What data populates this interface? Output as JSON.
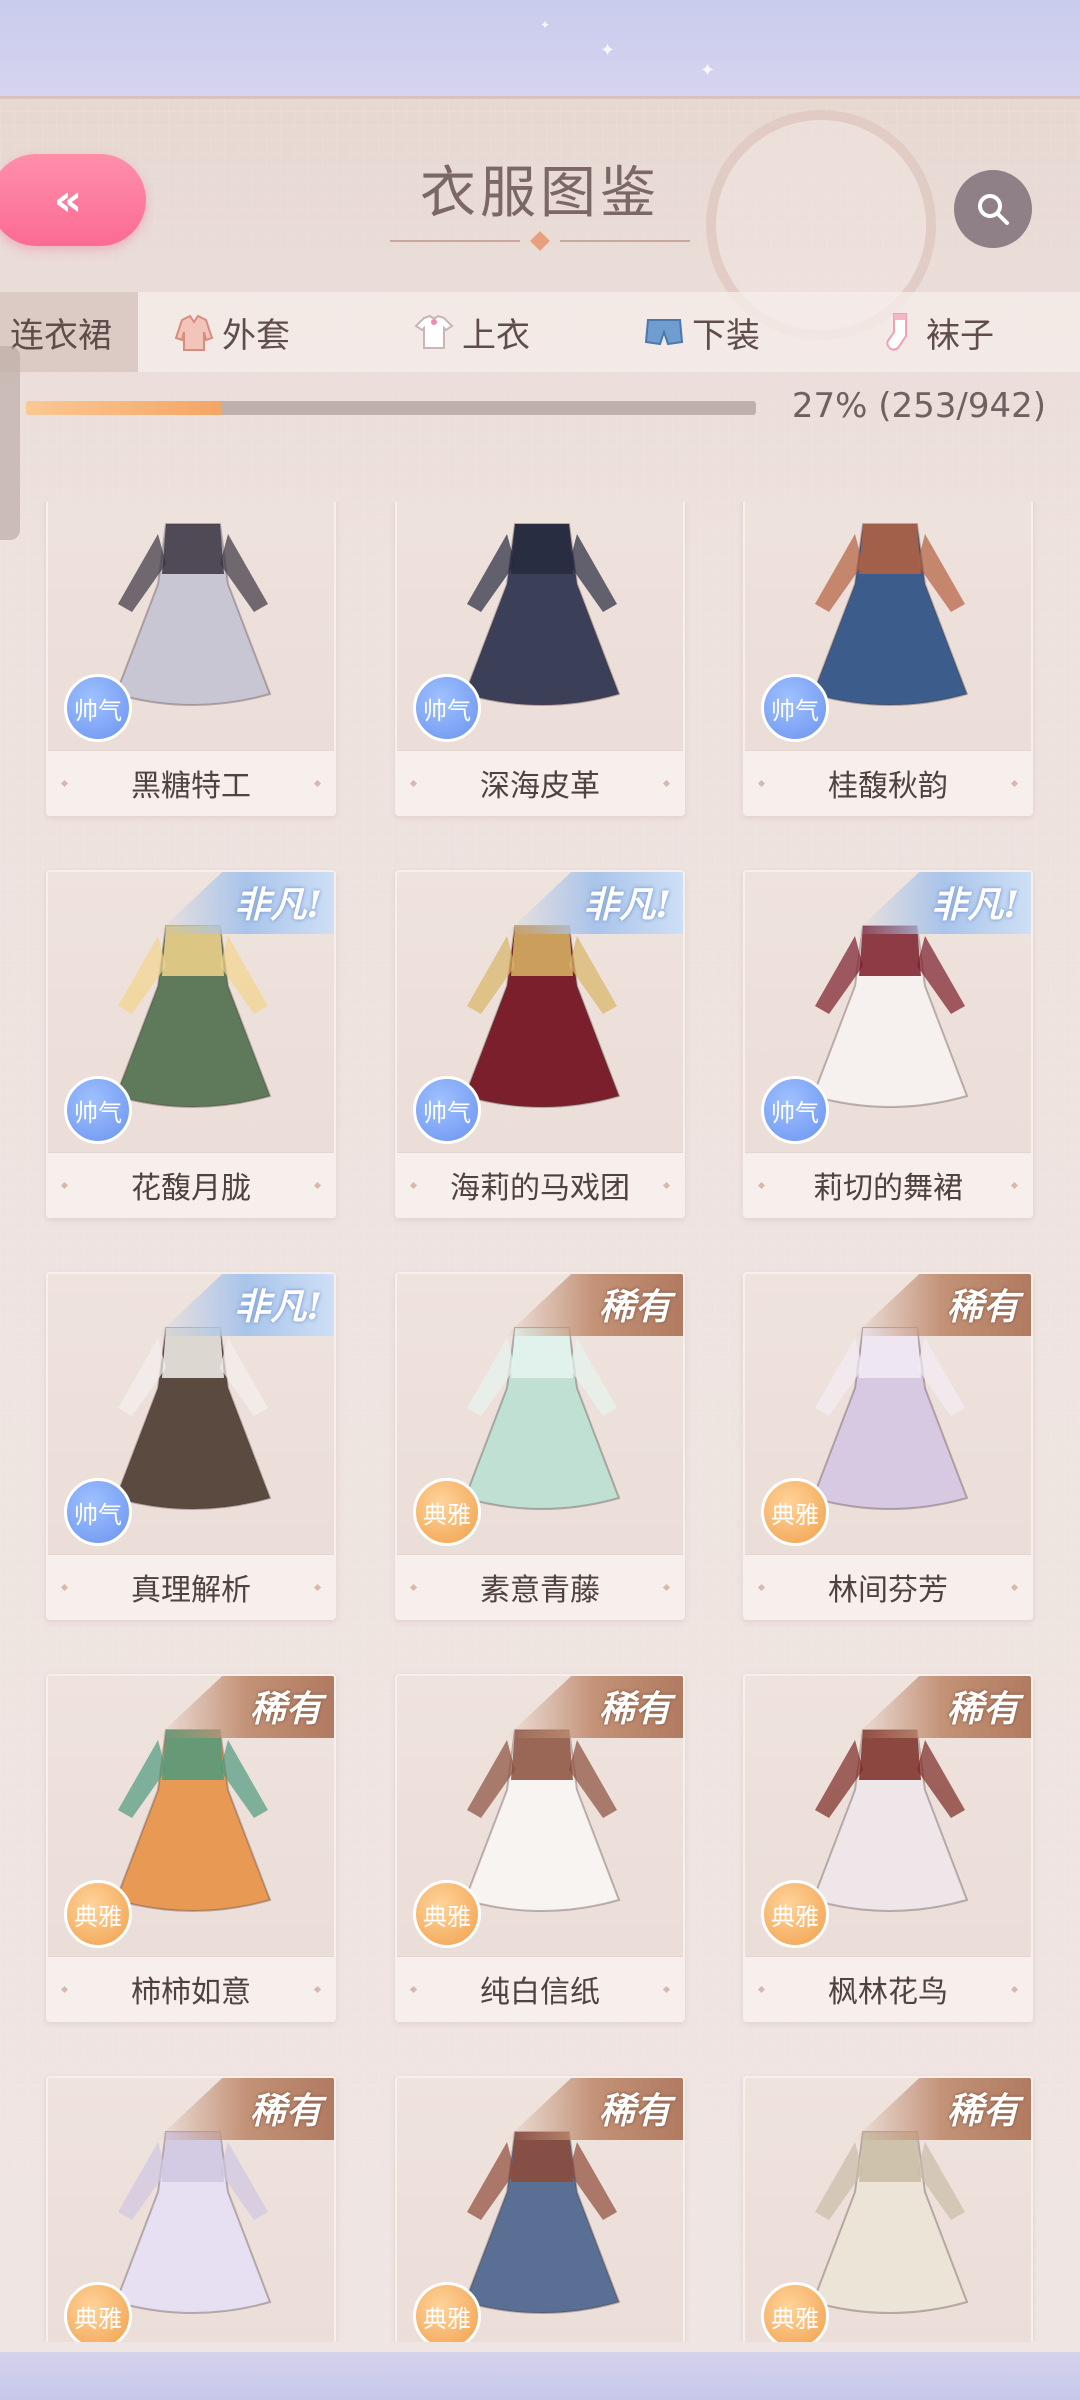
{
  "header": {
    "title": "衣服图鉴",
    "back_label": "«",
    "search_icon": "search-icon"
  },
  "tabs": [
    {
      "label": "连衣裙",
      "icon": "",
      "active": true
    },
    {
      "label": "外套",
      "icon": "coat-icon",
      "active": false
    },
    {
      "label": "上衣",
      "icon": "shirt-icon",
      "active": false
    },
    {
      "label": "下装",
      "icon": "shorts-icon",
      "active": false
    },
    {
      "label": "袜子",
      "icon": "sock-icon",
      "active": false
    }
  ],
  "progress": {
    "fraction": 0.2686,
    "text": "27% (253/942)"
  },
  "colors": {
    "cool_badge": "#6b93ef",
    "elegant_badge": "#f0a04c",
    "back_button": "#fb6b93"
  },
  "items": [
    {
      "name": "黑糖特工",
      "badge": "帅气",
      "rarity": "",
      "dress_color": "#c9c6d4",
      "accent": "#3b3440"
    },
    {
      "name": "深海皮革",
      "badge": "帅气",
      "rarity": "",
      "dress_color": "#3b3f58",
      "accent": "#262a3d"
    },
    {
      "name": "桂馥秋韵",
      "badge": "帅气",
      "rarity": "",
      "dress_color": "#3c5d8c",
      "accent": "#b4603e"
    },
    {
      "name": "花馥月胧",
      "badge": "帅气",
      "rarity": "非凡!",
      "dress_color": "#5f7a5a",
      "accent": "#f2d48c"
    },
    {
      "name": "海莉的马戏团",
      "badge": "帅气",
      "rarity": "非凡!",
      "dress_color": "#7a1f2b",
      "accent": "#d9b565"
    },
    {
      "name": "莉切的舞裙",
      "badge": "帅气",
      "rarity": "非凡!",
      "dress_color": "#f6f1ef",
      "accent": "#7a1c28"
    },
    {
      "name": "真理解析",
      "badge": "帅气",
      "rarity": "非凡!",
      "dress_color": "#5a4a40",
      "accent": "#f4f0ec"
    },
    {
      "name": "素意青藤",
      "badge": "典雅",
      "rarity": "稀有",
      "dress_color": "#bfe0d3",
      "accent": "#e6f3ee"
    },
    {
      "name": "林间芬芳",
      "badge": "典雅",
      "rarity": "稀有",
      "dress_color": "#d8c9e3",
      "accent": "#f2ecf4"
    },
    {
      "name": "柿柿如意",
      "badge": "典雅",
      "rarity": "稀有",
      "dress_color": "#e89a55",
      "accent": "#4f9a7e"
    },
    {
      "name": "纯白信纸",
      "badge": "典雅",
      "rarity": "稀有",
      "dress_color": "#f7f4f1",
      "accent": "#8a4e3c"
    },
    {
      "name": "枫林花鸟",
      "badge": "典雅",
      "rarity": "稀有",
      "dress_color": "#efe6ea",
      "accent": "#7a2a22"
    },
    {
      "name": "",
      "badge": "典雅",
      "rarity": "稀有",
      "dress_color": "#e6e0f2",
      "accent": "#cfc6e2"
    },
    {
      "name": "",
      "badge": "典雅",
      "rarity": "稀有",
      "dress_color": "#5a6f94",
      "accent": "#8e4a38"
    },
    {
      "name": "",
      "badge": "典雅",
      "rarity": "稀有",
      "dress_color": "#ece4d6",
      "accent": "#c9bca6"
    }
  ]
}
